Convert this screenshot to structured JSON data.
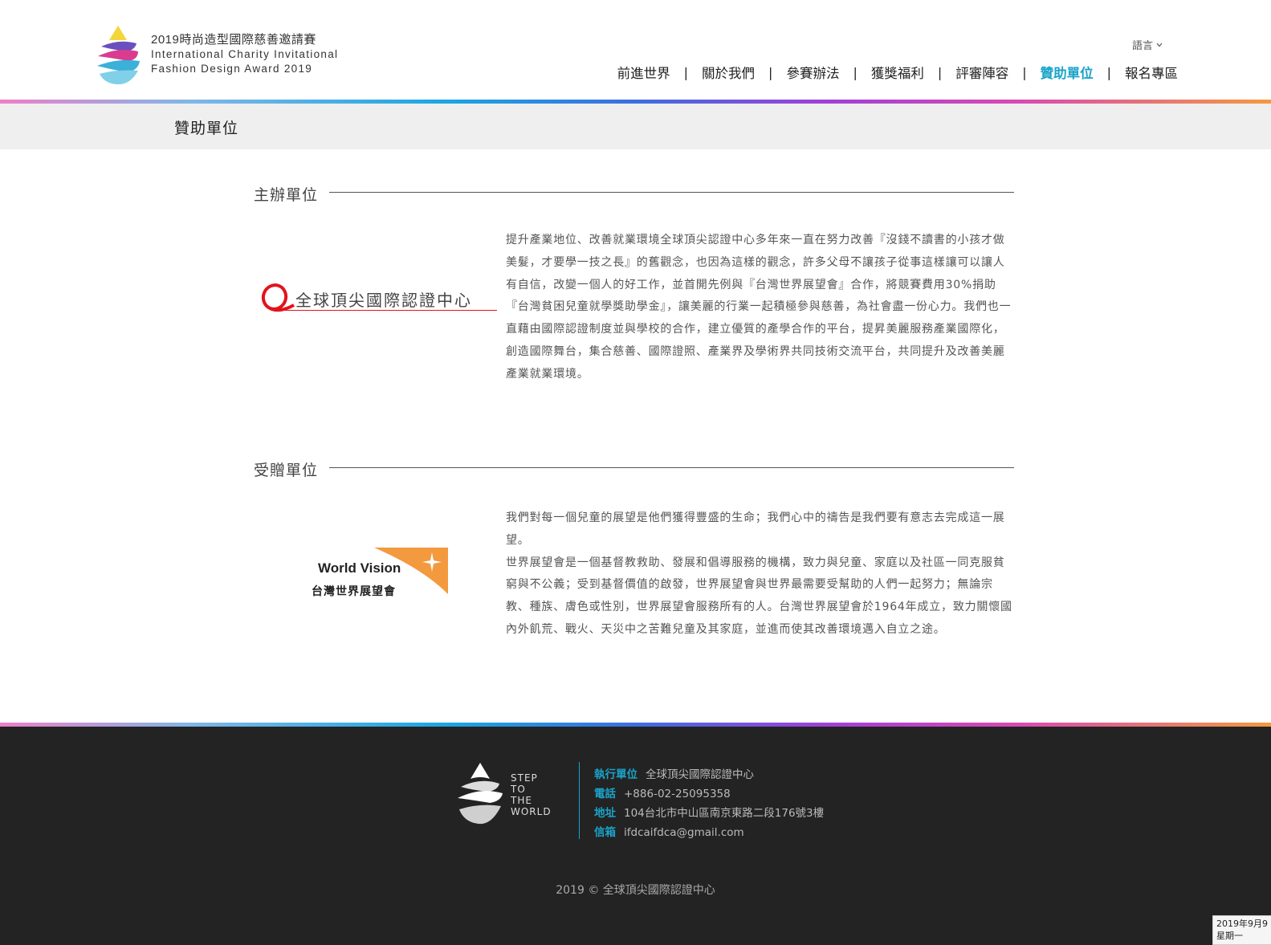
{
  "header": {
    "logo_line1": "2019時尚造型國際慈善邀請賽",
    "logo_line2": "International Charity Invitational",
    "logo_line3": "Fashion Design Award 2019",
    "lang_label": "語言",
    "nav": [
      {
        "label": "前進世界",
        "active": false
      },
      {
        "label": "關於我們",
        "active": false
      },
      {
        "label": "參賽辦法",
        "active": false
      },
      {
        "label": "獲獎福利",
        "active": false
      },
      {
        "label": "評審陣容",
        "active": false
      },
      {
        "label": "贊助單位",
        "active": true
      },
      {
        "label": "報名專區",
        "active": false
      }
    ],
    "nav_separator": "|"
  },
  "page_title": "贊助單位",
  "sections": [
    {
      "title": "主辦單位",
      "logo_text": "全球頂尖國際認證中心",
      "paragraphs": [
        "提升產業地位、改善就業環境全球頂尖認證中心多年來一直在努力改善『沒錢不讀書的小孩才做美髮，才要學一技之長』的舊觀念，也因為這樣的觀念，許多父母不讓孩子從事這樣讓可以讓人有自信，改變一個人的好工作，並首開先例與『台灣世界展望會』合作，將競賽費用30%捐助『台灣貧困兒童就學獎助學金』，讓美麗的行業一起積極參與慈善，為社會盡一份心力。我們也一直藉由國際認證制度並與學校的合作，建立優質的產學合作的平台，提昇美麗服務產業國際化，創造國際舞台，集合慈善、國際證照、產業界及學術界共同技術交流平台，共同提升及改善美麗產業就業環境。"
      ]
    },
    {
      "title": "受贈單位",
      "logo_text_en": "World Vision",
      "logo_text_zh": "台灣世界展望會",
      "paragraphs": [
        "我們對每一個兒童的展望是他們獲得豐盛的生命；我們心中的禱告是我們要有意志去完成這一展望。",
        "世界展望會是一個基督教救助、發展和倡導服務的機構，致力與兒童、家庭以及社區一同克服貧窮與不公義；受到基督價值的啟發，世界展望會與世界最需要受幫助的人們一起努力；無論宗教、種族、膚色或性別，世界展望會服務所有的人。台灣世界展望會於1964年成立，致力關懷國內外飢荒、戰火、天災中之苦難兒童及其家庭，並進而使其改善環境邁入自立之途。"
      ]
    }
  ],
  "footer": {
    "logo_words": [
      "STEP",
      "TO",
      "THE",
      "WORLD"
    ],
    "rows": [
      {
        "label": "執行單位",
        "value": "全球頂尖國際認證中心"
      },
      {
        "label": "電話",
        "value": "+886-02-25095358"
      },
      {
        "label": "地址",
        "value": "104台北市中山區南京東路二段176號3樓"
      },
      {
        "label": "信箱",
        "value": "ifdcaifdca@gmail.com"
      }
    ],
    "copyright": "2019 © 全球頂尖國際認證中心"
  },
  "taskbar_clock": {
    "date": "2019年9月9",
    "weekday": "星期一"
  },
  "colors": {
    "accent": "#1aa3c9",
    "footer_bg": "#232323",
    "band_bg": "#efefef"
  }
}
